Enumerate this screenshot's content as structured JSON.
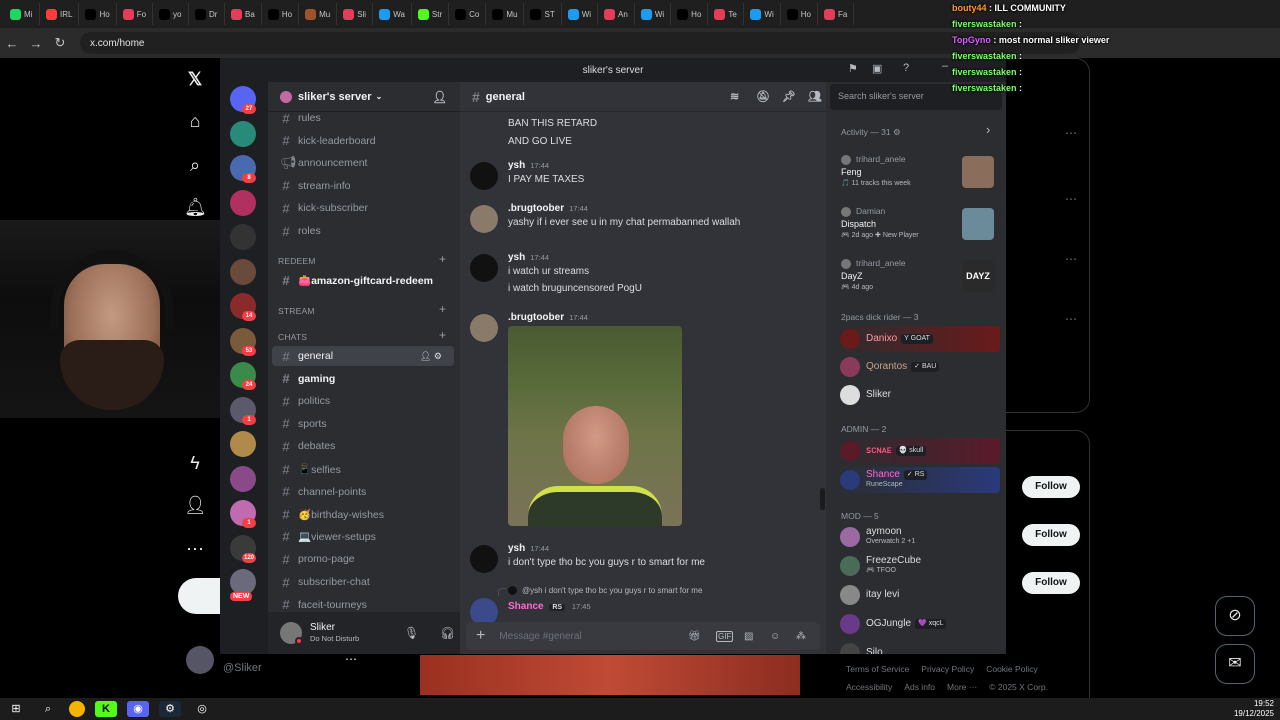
{
  "browser": {
    "tabs": [
      {
        "label": "Mi",
        "color": "#1ed760",
        "icon": "spotify-icon"
      },
      {
        "label": "IRL",
        "color": "#ff3b3b",
        "icon": "red-icon"
      },
      {
        "label": "Ho",
        "color": "#000000",
        "icon": "x-icon"
      },
      {
        "label": "Fo",
        "color": "#e33d5a",
        "icon": "pink-icon"
      },
      {
        "label": "yo",
        "color": "#000000",
        "icon": "x-icon"
      },
      {
        "label": "Dr",
        "color": "#000000",
        "icon": "x-icon"
      },
      {
        "label": "Ba",
        "color": "#e33d5a",
        "icon": "pink-icon"
      },
      {
        "label": "Ho",
        "color": "#000000",
        "icon": "x-icon"
      },
      {
        "label": "Mu",
        "color": "#a0522d",
        "icon": "brown-icon"
      },
      {
        "label": "Sli",
        "color": "#e33d5a",
        "icon": "pink-icon"
      },
      {
        "label": "Wa",
        "color": "#1d9bf0",
        "icon": "blue-icon"
      },
      {
        "label": "Str",
        "color": "#53fc18",
        "icon": "kick-icon"
      },
      {
        "label": "Co",
        "color": "#000000",
        "icon": "x-icon"
      },
      {
        "label": "Mu",
        "color": "#000000",
        "icon": "x-icon"
      },
      {
        "label": "ST",
        "color": "#000000",
        "icon": "tiktok-icon"
      },
      {
        "label": "Wi",
        "color": "#1d9bf0",
        "icon": "blue-icon"
      },
      {
        "label": "An",
        "color": "#e33d5a",
        "icon": "pink-icon"
      },
      {
        "label": "Wi",
        "color": "#1d9bf0",
        "icon": "blue-icon"
      },
      {
        "label": "Ho",
        "color": "#000000",
        "icon": "x-icon"
      },
      {
        "label": "Te",
        "color": "#e33d5a",
        "icon": "pink-icon"
      },
      {
        "label": "Wi",
        "color": "#1d9bf0",
        "icon": "blue-icon"
      },
      {
        "label": "Ho",
        "color": "#000000",
        "icon": "x-icon"
      },
      {
        "label": "Fa",
        "color": "#e33d5a",
        "icon": "pink-icon"
      }
    ],
    "url": "x.com/home"
  },
  "stream_chat": [
    {
      "user": "bouty44",
      "text": " : ILL COMMUNITY",
      "color": "#ff9a3c"
    },
    {
      "user": "fiverswastaken",
      "text": " :",
      "color": "#7cff6b"
    },
    {
      "user": "TopGyno",
      "text": " : most normal sliker viewer",
      "color": "#e05cff"
    },
    {
      "user": "fiverswastaken",
      "text": " :",
      "color": "#7cff6b"
    },
    {
      "user": "fiverswastaken",
      "text": " :",
      "color": "#7cff6b"
    },
    {
      "user": "fiverswastaken",
      "text": " :",
      "color": "#7cff6b"
    }
  ],
  "discord": {
    "window_title": "sliker's server",
    "server_name": "sliker's server",
    "channels_top": [
      "rules",
      "kick-leaderboard",
      "announcement",
      "stream-info",
      "kick-subscriber",
      "roles"
    ],
    "cat_redeem": "REDEEM",
    "redeem_channel": "👛amazon-giftcard-redeem",
    "cat_stream": "STREAM",
    "cat_chats": "CHATS",
    "chat_channels": [
      "general",
      "gaming",
      "politics",
      "sports",
      "debates",
      "📱selfies",
      "channel-points",
      "🥳birthday-wishes",
      "💻viewer-setups",
      "promo-page",
      "subscriber-chat",
      "faceit-tourneys"
    ],
    "user": {
      "name": "Sliker",
      "status": "Do Not Disturb"
    },
    "channel_title": "general",
    "search_placeholder": "Search sliker's server",
    "messages": [
      {
        "text": "BAN THIS RETARD"
      },
      {
        "text": "AND GO LIVE"
      },
      {
        "author": "ysh",
        "time": "17:44",
        "lines": [
          "I PAY ME TAXES"
        ]
      },
      {
        "author": ".brugtoober",
        "time": "17:44",
        "lines": [
          "yashy if i ever see u in my chat permabanned wallah"
        ]
      },
      {
        "author": "ysh",
        "time": "17:44",
        "lines": [
          "i watch ur streams",
          "i watch bruguncensored PogU"
        ]
      },
      {
        "author": ".brugtoober",
        "time": "17:44",
        "lines": []
      },
      {
        "author": "ysh",
        "time": "17:44",
        "lines": [
          "i don't type tho bc you guys r to smart for me"
        ]
      }
    ],
    "reply_preview": "@ysh i don't type tho bc you guys r to smart for me",
    "reply_author": "Shance",
    "reply_tag": "RS",
    "reply_time": "17:45",
    "composer_placeholder": "Message #general",
    "activity_header": "Activity — 31 ⚙",
    "activities": [
      {
        "user": "trihard_anele",
        "title": "Feng",
        "sub": "🎵 11 tracks this week",
        "thumb": "#8a6d5a"
      },
      {
        "user": "Damian",
        "title": "Dispatch",
        "sub": "🎮 2d ago  ✚ New Player",
        "thumb": "#6b8a9a"
      },
      {
        "user": "trihard_anele",
        "title": "DayZ",
        "sub": "🎮 4d ago",
        "thumb": "#2a2a2a",
        "thumb_text": "DAYZ"
      }
    ],
    "role1_header": "2pacs dick rider — 3",
    "role1": [
      {
        "name": "Danixo",
        "tag": "Y GOAT",
        "color": "#6b1a1a",
        "text": "#ff9aa0"
      },
      {
        "name": "Qorantos",
        "tag": "✓ BAU",
        "color": "#8a3a5a",
        "text": "#c9a08a"
      },
      {
        "name": "Sliker",
        "tag": "",
        "color": "#ddd",
        "text": "#dbdee1"
      }
    ],
    "admin_header": "ADMIN — 2",
    "admins": [
      {
        "name": "ꜱᴄɴᴀᴇ",
        "tag": "💀 skull",
        "color": "#5a1a2a",
        "text": "#ff6b8a"
      },
      {
        "name": "Shance",
        "tag": "✓ RS",
        "sub": "RuneScape",
        "color": "#2a3a7a",
        "text": "#ff6bd0"
      }
    ],
    "mod_header": "MOD — 5",
    "mods": [
      {
        "name": "aymoon",
        "sub": "Overwatch 2 +1",
        "color": "#9a6aa0"
      },
      {
        "name": "FreezeCube",
        "sub": "🎮 TFOO",
        "color": "#4a6a5a"
      },
      {
        "name": "itay levi",
        "sub": "",
        "color": "#888"
      },
      {
        "name": "OGJungle",
        "tag": "💜 xqcL",
        "color": "#6a3a8a"
      },
      {
        "name": "Silo",
        "sub": "",
        "color": "#444"
      }
    ]
  },
  "x": {
    "follow_label": "Follow",
    "account_name": "@Sliker",
    "footer": [
      "Terms of Service",
      "Privacy Policy",
      "Cookie Policy",
      "Accessibility",
      "Ads info",
      "More ···",
      "© 2025 X Corp."
    ]
  },
  "taskbar": {
    "time": "19:52",
    "date": "19/12/2025"
  }
}
